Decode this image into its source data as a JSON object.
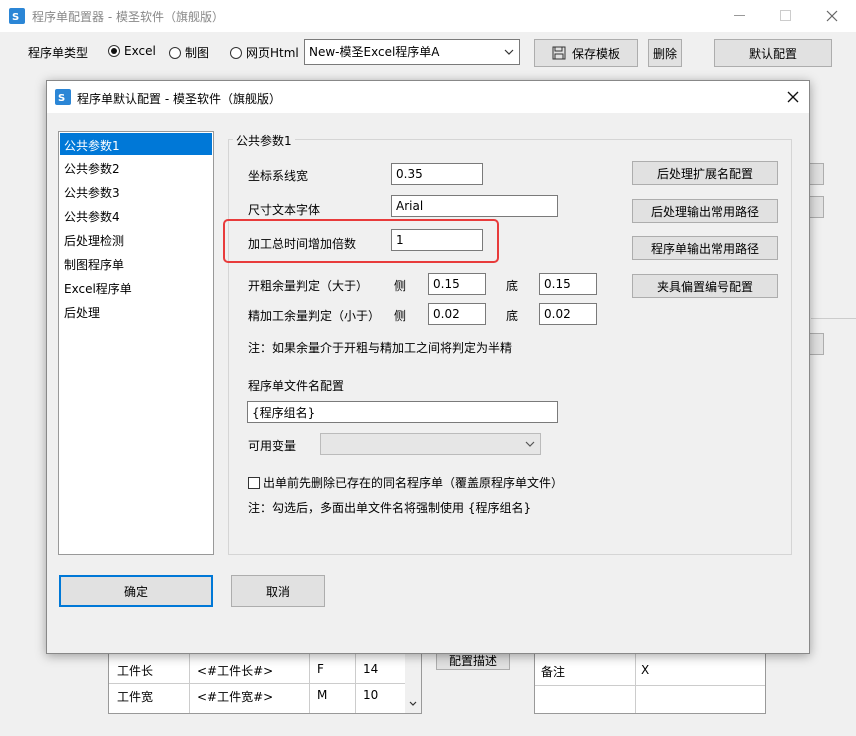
{
  "main": {
    "title": "程序单配置器 - 模圣软件（旗舰版）",
    "type_label": "程序单类型",
    "radio_excel": "Excel",
    "radio_drawing": "制图",
    "radio_web": "网页Html",
    "template_value": "New-模圣Excel程序单A",
    "save_template": "保存模板",
    "delete": "删除",
    "default_config": "默认配置",
    "config_desc": "配置描述"
  },
  "bg_table_left": {
    "rows": [
      [
        "工件长",
        "<#工件长#>",
        "F",
        "14"
      ],
      [
        "工件宽",
        "<#工件宽#>",
        "M",
        "10"
      ]
    ]
  },
  "bg_table_right": {
    "rows": [
      [
        "备注",
        "X"
      ]
    ]
  },
  "dialog": {
    "title": "程序单默认配置 - 模圣软件（旗舰版）",
    "nav": [
      "公共参数1",
      "公共参数2",
      "公共参数3",
      "公共参数4",
      "后处理检测",
      "制图程序单",
      "Excel程序单",
      "后处理"
    ],
    "group_title": "公共参数1",
    "coord_width_label": "坐标系线宽",
    "coord_width_value": "0.35",
    "dim_font_label": "尺寸文本字体",
    "dim_font_value": "Arial",
    "time_mult_label": "加工总时间增加倍数",
    "time_mult_value": "1",
    "rough_label": "开粗余量判定（大于）",
    "rough_side_label": "侧",
    "rough_side_value": "0.15",
    "rough_bottom_label": "底",
    "rough_bottom_value": "0.15",
    "finish_label": "精加工余量判定（小于）",
    "finish_side_label": "侧",
    "finish_side_value": "0.02",
    "finish_bottom_label": "底",
    "finish_bottom_value": "0.02",
    "note1": "注：如果余量介于开粗与精加工之间将判定为半精",
    "filename_label": "程序单文件名配置",
    "filename_value": "{程序组名}",
    "vars_label": "可用变量",
    "checkbox_label": "出单前先删除已存在的同名程序单（覆盖原程序单文件）",
    "note2": "注：勾选后，多面出单文件名将强制使用 {程序组名}",
    "btn_ext": "后处理扩展名配置",
    "btn_post_path": "后处理输出常用路径",
    "btn_sheet_path": "程序单输出常用路径",
    "btn_fixture": "夹具偏置编号配置",
    "ok": "确定",
    "cancel": "取消"
  }
}
